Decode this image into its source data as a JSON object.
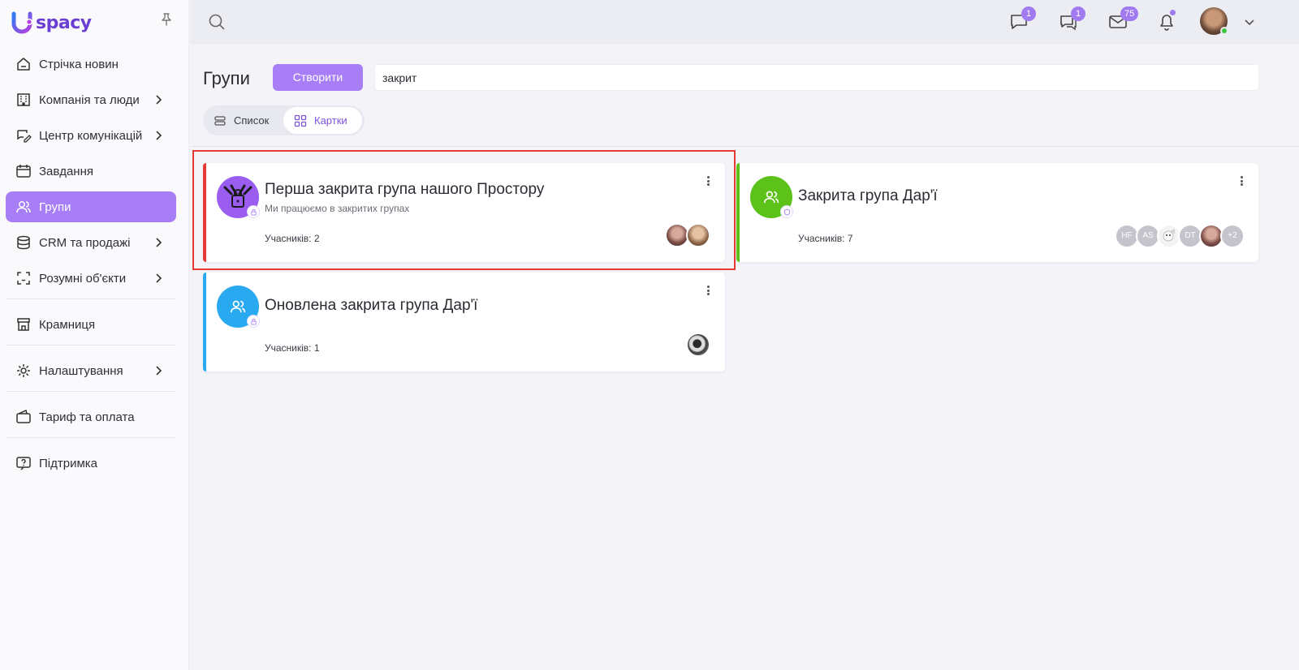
{
  "app": {
    "logo_text": "spacy",
    "brand_color": "#6b3fd4",
    "accent_color": "#a77ef5"
  },
  "sidebar": {
    "items": [
      {
        "label": "Стрічка новин",
        "icon": "home-icon",
        "chevron": false
      },
      {
        "label": "Компанія та люди",
        "icon": "building-icon",
        "chevron": true
      },
      {
        "label": "Центр комунікацій",
        "icon": "chat-edit-icon",
        "chevron": true
      },
      {
        "label": "Завдання",
        "icon": "calendar-icon",
        "chevron": false
      },
      {
        "label": "Групи",
        "icon": "users-icon",
        "chevron": false,
        "active": true
      },
      {
        "label": "CRM та продажі",
        "icon": "database-icon",
        "chevron": true
      },
      {
        "label": "Розумні об'єкти",
        "icon": "scan-icon",
        "chevron": true
      },
      {
        "label": "Крамниця",
        "icon": "store-icon",
        "chevron": false
      },
      {
        "label": "Налаштування",
        "icon": "gear-icon",
        "chevron": true
      },
      {
        "label": "Тариф та оплата",
        "icon": "wallet-icon",
        "chevron": false
      },
      {
        "label": "Підтримка",
        "icon": "help-icon",
        "chevron": false
      }
    ]
  },
  "header": {
    "badges": {
      "chat": "1",
      "comments": "1",
      "mail": "75"
    }
  },
  "main": {
    "title": "Групи",
    "create_label": "Створити",
    "search_value": "закрит",
    "view": {
      "list_label": "Список",
      "cards_label": "Картки",
      "selected": "cards"
    }
  },
  "groups": [
    {
      "title": "Перша закрита група нашого Простору",
      "subtitle": "Ми працюємо в закритих групах",
      "members": "Учасників: 2",
      "accent": "#e53935",
      "avatar_color": "#9a5df0"
    },
    {
      "title": "Закрита група Дар'ї",
      "subtitle": "",
      "members": "Учасників: 7",
      "accent": "#5cc21a",
      "avatar_color": "#5cc21a",
      "member_initials": [
        "HF",
        "AS",
        "DT",
        "+2"
      ]
    },
    {
      "title": "Оновлена закрита група Дар'ї",
      "subtitle": "",
      "members": "Учасників: 1",
      "accent": "#29a9f0",
      "avatar_color": "#29a9f0"
    }
  ]
}
